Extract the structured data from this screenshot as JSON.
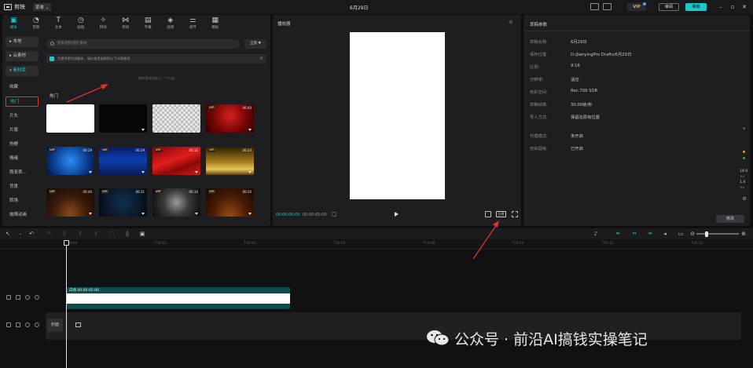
{
  "titlebar": {
    "app_name": "剪映",
    "menu_label": "菜单 ⌄",
    "project_title": "6月29日",
    "vip_label": "VIP",
    "review_label": "审阅",
    "export_label": "导出",
    "window_buttons": [
      "–",
      "▫",
      "✕"
    ]
  },
  "media_toolbar": {
    "tabs": [
      {
        "label": "媒体",
        "icon": "media-icon",
        "glyph": "▣",
        "active": true
      },
      {
        "label": "音频",
        "icon": "audio-icon",
        "glyph": "◔",
        "active": false
      },
      {
        "label": "文本",
        "icon": "text-icon",
        "glyph": "T",
        "active": false
      },
      {
        "label": "贴纸",
        "icon": "sticker-icon",
        "glyph": "◷",
        "active": false
      },
      {
        "label": "特效",
        "icon": "effects-icon",
        "glyph": "✧",
        "active": false
      },
      {
        "label": "转场",
        "icon": "transition-icon",
        "glyph": "⋈",
        "active": false
      },
      {
        "label": "字幕",
        "icon": "subtitle-icon",
        "glyph": "▤",
        "active": false
      },
      {
        "label": "滤镜",
        "icon": "filter-icon",
        "glyph": "◈",
        "active": false
      },
      {
        "label": "调节",
        "icon": "adjust-icon",
        "glyph": "⚌",
        "active": false
      },
      {
        "label": "模板",
        "icon": "template-icon",
        "glyph": "▦",
        "active": false
      }
    ]
  },
  "media_sidebar": {
    "items": [
      {
        "label": "▸ 本地",
        "kind": "group"
      },
      {
        "label": "▸ 云素材",
        "kind": "group"
      },
      {
        "label": "▾ 素材库",
        "kind": "group-active"
      },
      {
        "label": "收藏",
        "kind": "item"
      },
      {
        "label": "热门",
        "kind": "highlight"
      },
      {
        "label": "片头",
        "kind": "item"
      },
      {
        "label": "片尾",
        "kind": "item"
      },
      {
        "label": "热梗",
        "kind": "item"
      },
      {
        "label": "情绪",
        "kind": "item"
      },
      {
        "label": "萌宠表...",
        "kind": "item"
      },
      {
        "label": "背景",
        "kind": "item"
      },
      {
        "label": "转场",
        "kind": "item"
      },
      {
        "label": "故障动画",
        "kind": "item"
      }
    ]
  },
  "library": {
    "search_placeholder": "搜索视频/图片素材",
    "filter_label": "全部 ▼",
    "notice_text": "为提供更优质服务，请在使用前授权以下内容使用",
    "notice_close": "✕",
    "refresh_hint": "刷新素材加载上一个分类",
    "section_label": "热门",
    "thumbnails": [
      {
        "style": "white",
        "vip": "",
        "duration": "",
        "download": false
      },
      {
        "style": "black",
        "vip": "",
        "duration": "",
        "download": true
      },
      {
        "style": "trans",
        "vip": "",
        "duration": "",
        "download": true
      },
      {
        "style": "red1",
        "vip": "VIP",
        "duration": "00:40",
        "download": true
      },
      {
        "style": "blue1",
        "vip": "VIP",
        "duration": "00:29",
        "download": true
      },
      {
        "style": "blue2",
        "vip": "VIP",
        "duration": "00:29",
        "download": true
      },
      {
        "style": "red2",
        "vip": "VIP",
        "duration": "00:11",
        "download": true
      },
      {
        "style": "gold",
        "vip": "VIP",
        "duration": "00:24",
        "download": true
      },
      {
        "style": "brown",
        "vip": "VIP",
        "duration": "00:46",
        "download": true
      },
      {
        "style": "navy",
        "vip": "VIP",
        "duration": "00:31",
        "download": true
      },
      {
        "style": "grey",
        "vip": "VIP",
        "duration": "00:10",
        "download": true
      },
      {
        "style": "orange",
        "vip": "VIP",
        "duration": "00:26",
        "download": true
      }
    ]
  },
  "player": {
    "title": "播放器",
    "menu": "≡",
    "current_time": "00:00:00:00",
    "total_time": "00:00:05:00",
    "ratio_label": "比例"
  },
  "draft_params": {
    "title": "草稿参数",
    "rows": [
      {
        "key": "草稿名称:",
        "value": "6月29日"
      },
      {
        "key": "保存位置:",
        "value": "D:/JianyingPro Drafts/6月29日"
      },
      {
        "key": "比例:",
        "value": "9:16"
      },
      {
        "key": "分辨率:",
        "value": "适应"
      },
      {
        "key": "色彩空间:",
        "value": "Rec.709 SDR"
      },
      {
        "key": "草稿帧率:",
        "value": "30.00帧/秒"
      },
      {
        "key": "导入方式:",
        "value": "保留在原有位置"
      },
      {
        "key": "代理模式:",
        "value": "未开启"
      },
      {
        "key": "自由层级:",
        "value": "已开启"
      }
    ],
    "modify_label": "修改"
  },
  "side_meter": {
    "value_top": "14.0",
    "unit_top": "K/s",
    "value_bottom": "1.4",
    "unit_bottom": "K/s"
  },
  "ruler": {
    "labels": [
      "00:00",
      "00:02",
      "00:04",
      "00:06",
      "00:08",
      "00:10",
      "00:12",
      "00:14"
    ]
  },
  "timeline": {
    "clip_label": "白场  00:00:05:00",
    "cover_label": "封面"
  },
  "watermark": {
    "text": "公众号 · 前沿AI搞钱实操笔记"
  },
  "colors": {
    "accent": "#1ec7c7",
    "highlight_red": "#e0322e",
    "clip_teal": "#0e4d4d"
  }
}
